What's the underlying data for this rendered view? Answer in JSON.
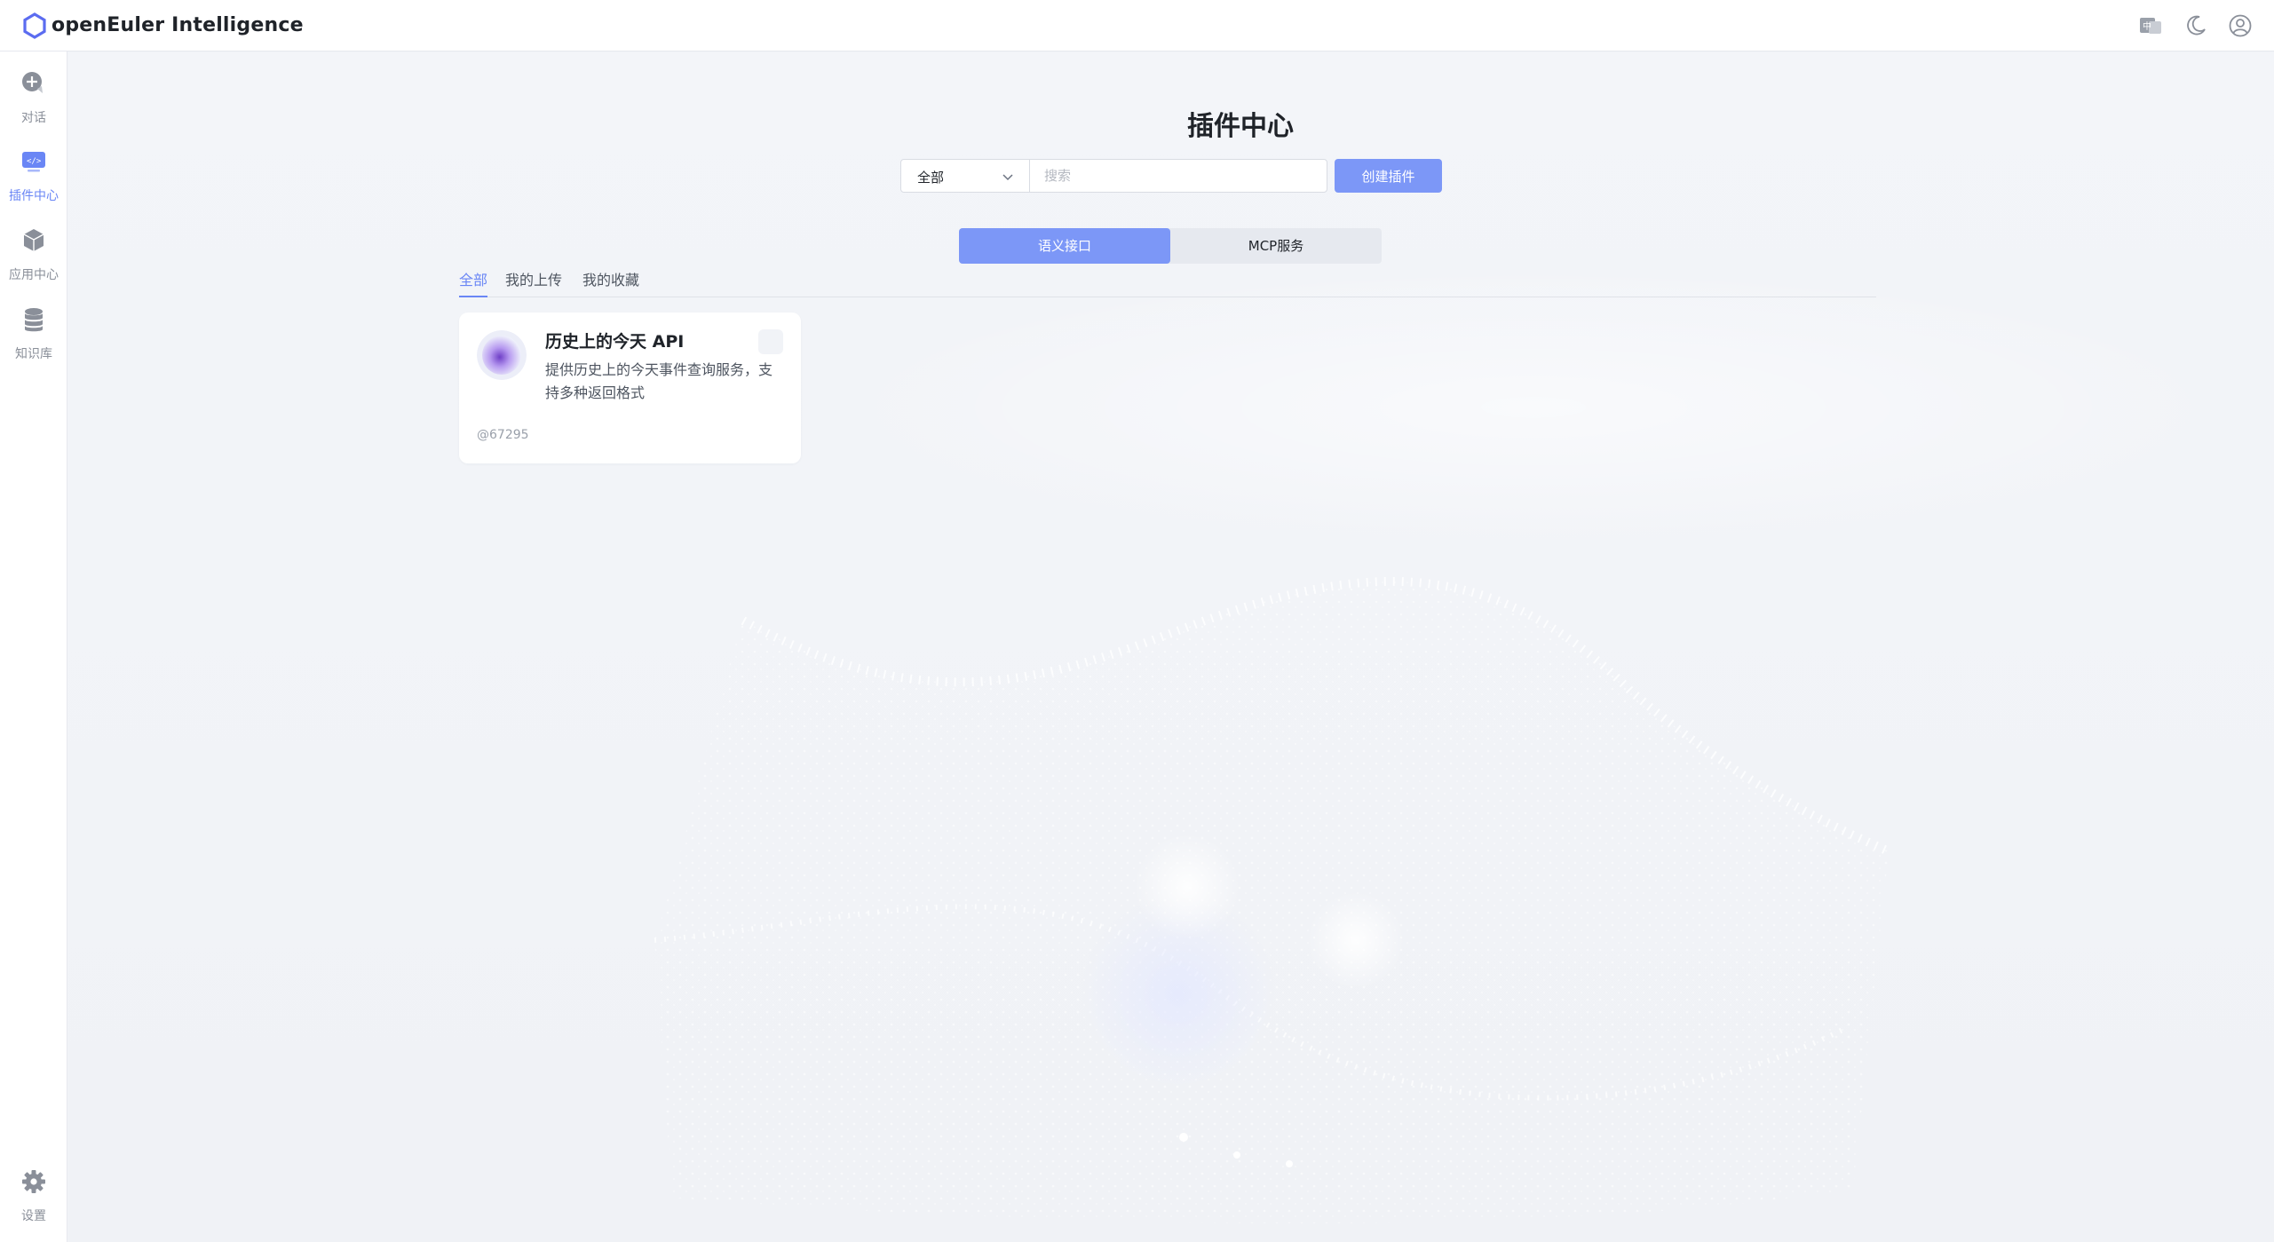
{
  "app": {
    "title": "openEuler Intelligence"
  },
  "topbar": {
    "icons": [
      "language-icon",
      "moon-icon",
      "user-icon"
    ]
  },
  "sidebar": {
    "items": [
      {
        "label": "对话",
        "icon": "chat-plus-icon",
        "active": false
      },
      {
        "label": "插件中心",
        "icon": "plugin-code-icon",
        "active": true
      },
      {
        "label": "应用中心",
        "icon": "cube-icon",
        "active": false
      },
      {
        "label": "知识库",
        "icon": "database-icon",
        "active": false
      }
    ],
    "settings": {
      "label": "设置",
      "icon": "gear-icon"
    }
  },
  "main": {
    "title": "插件中心",
    "filter": {
      "selected": "全部"
    },
    "search": {
      "placeholder": "搜索",
      "value": ""
    },
    "create_label": "创建插件",
    "segments": [
      {
        "label": "语义接口",
        "active": true
      },
      {
        "label": "MCP服务",
        "active": false
      }
    ],
    "tabs": [
      {
        "label": "全部",
        "active": true
      },
      {
        "label": "我的上传",
        "active": false
      },
      {
        "label": "我的收藏",
        "active": false
      }
    ],
    "cards": [
      {
        "title": "历史上的今天 API",
        "description": "提供历史上的今天事件查询服务，支持多种返回格式",
        "author": "@67295"
      }
    ]
  },
  "colors": {
    "accent": "#7c97f7",
    "accent_text": "#6a86f5",
    "background": "#f2f4f8"
  }
}
